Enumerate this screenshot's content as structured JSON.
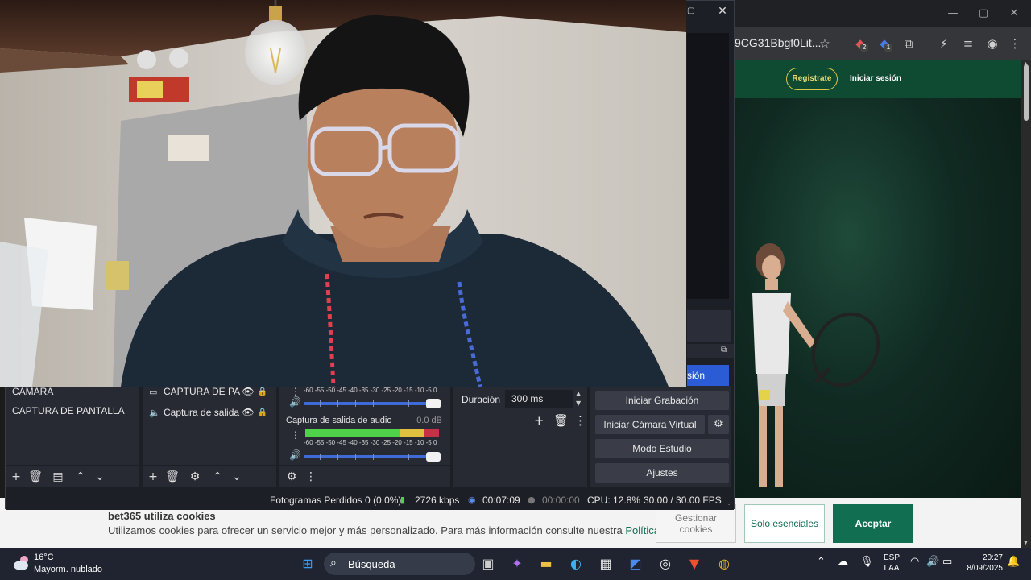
{
  "browser": {
    "url_fragment": "9CG31Bbgf0Lit...",
    "window_controls": {
      "minimize": "—",
      "maximize": "▢",
      "close": "✕"
    },
    "extension_badges": [
      "2",
      "1"
    ]
  },
  "site": {
    "register_label": "Registrate",
    "login_label": "Iniciar sesión",
    "cookie_banner": {
      "title": "bet365 utiliza cookies",
      "text": "Utilizamos cookies para ofrecer un servicio mejor y más personalizado. Para más información consulte nuestra ",
      "link": "Política de cookies",
      "manage_label": "Gestionar cookies",
      "essential_label": "Solo esenciales",
      "accept_label": "Aceptar"
    }
  },
  "obs": {
    "close_glyph": "✕",
    "blue_button_label": "sión",
    "scenes": [
      "CÁMARA",
      "CAPTURA DE PANTALLA"
    ],
    "sources": [
      {
        "icon": "monitor-icon",
        "label": "CAPTURA DE PANTALLA"
      },
      {
        "icon": "speaker-icon",
        "label": "Captura de salida"
      }
    ],
    "mixer": {
      "ticks": "-60 -55 -50 -45 -40 -35 -30 -25 -20 -15 -10  -5   0",
      "channel_label": "Captura de salida de audio",
      "channel_db": "0.0 dB"
    },
    "transitions": {
      "duration_label": "Duración",
      "duration_value": "300 ms"
    },
    "controls": {
      "start_recording": "Iniciar Grabación",
      "start_virtual_cam": "Iniciar Cámara Virtual",
      "studio_mode": "Modo Estudio",
      "settings": "Ajustes"
    },
    "status": {
      "dropped_frames": "Fotogramas Perdidos 0 (0.0%)",
      "bitrate": "2726 kbps",
      "stream_time": "00:07:09",
      "record_time": "00:00:00",
      "cpu": "CPU: 12.8%",
      "fps": "30.00 / 30.00 FPS"
    }
  },
  "taskbar": {
    "weather_temp": "16°C",
    "weather_desc": "Mayorm. nublado",
    "search_placeholder": "Búsqueda",
    "lang_line1": "ESP",
    "lang_line2": "LAA",
    "time": "20:27",
    "date": "8/09/2025"
  },
  "colors": {
    "obs_bg": "#1d1f26",
    "obs_dock": "#272a33",
    "obs_accent": "#2c5bd6",
    "site_green": "#126e51"
  }
}
